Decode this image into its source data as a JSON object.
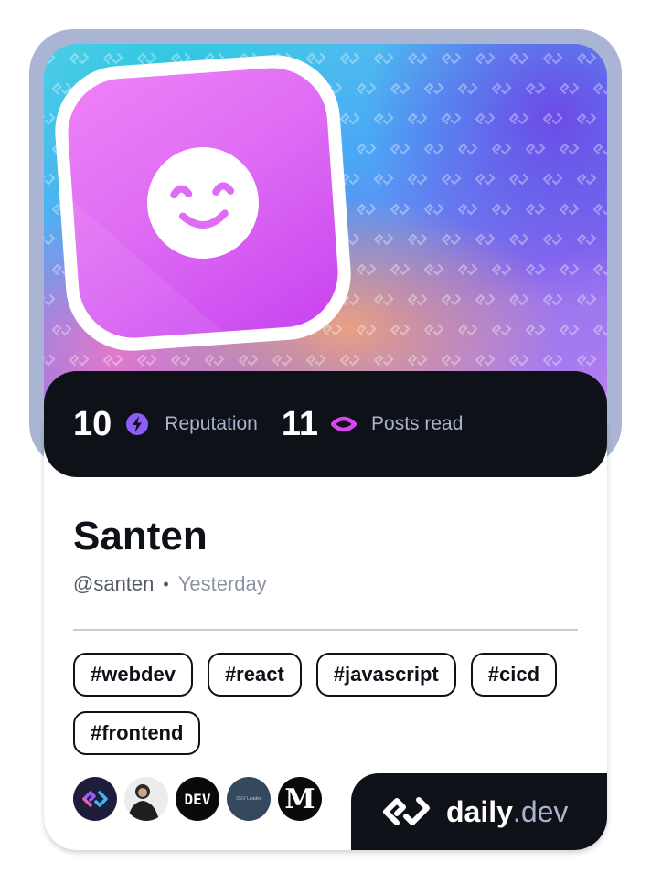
{
  "profile": {
    "name": "Santen",
    "handle": "@santen",
    "separator": "•",
    "joined": "Yesterday",
    "avatar_icon": "smiley-face-icon"
  },
  "stats": {
    "reputation": {
      "value": "10",
      "label": "Reputation",
      "icon": "lightning-icon",
      "color": "#8b5cf6"
    },
    "posts_read": {
      "value": "11",
      "label": "Posts read",
      "icon": "eye-icon",
      "color": "#d946ef"
    }
  },
  "tags": [
    "#webdev",
    "#react",
    "#javascript",
    "#cicd",
    "#frontend"
  ],
  "sources": [
    {
      "name": "daily-dev-source-icon"
    },
    {
      "name": "person-avatar-icon"
    },
    {
      "name": "dev-to-icon",
      "text": "DEV"
    },
    {
      "name": "dev-leader-icon",
      "text": "DEV Leader"
    },
    {
      "name": "medium-icon",
      "text": "M"
    }
  ],
  "brand": {
    "name": "daily",
    "suffix": ".dev"
  },
  "colors": {
    "frame": "#a9b5d3",
    "dark": "#0e1117",
    "avatar": "#df6cf4",
    "muted": "#a8b3cf"
  }
}
